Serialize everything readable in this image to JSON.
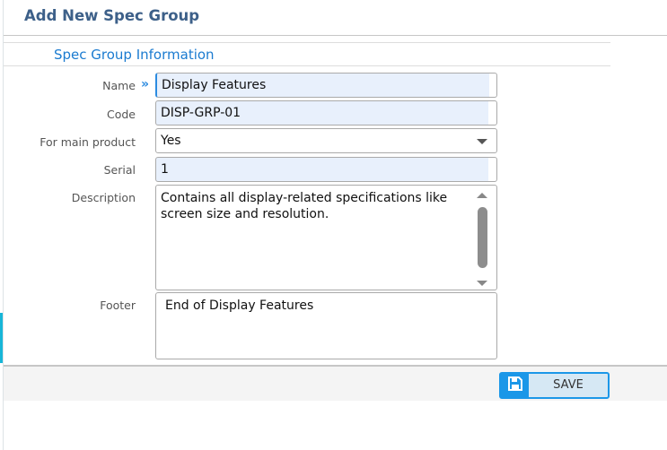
{
  "header": {
    "title": "Add New Spec Group"
  },
  "section": {
    "title": "Spec Group Information"
  },
  "form": {
    "name": {
      "label": "Name",
      "value": "Display Features"
    },
    "code": {
      "label": "Code",
      "value": "DISP-GRP-01"
    },
    "main_product": {
      "label": "For main product",
      "value": "Yes"
    },
    "serial": {
      "label": "Serial",
      "value": "1"
    },
    "description": {
      "label": "Description",
      "value": "Contains all display-related specifications like screen size and resolution."
    },
    "footer": {
      "label": "Footer",
      "value": "End of Display Features"
    }
  },
  "actions": {
    "save_label": "SAVE"
  }
}
